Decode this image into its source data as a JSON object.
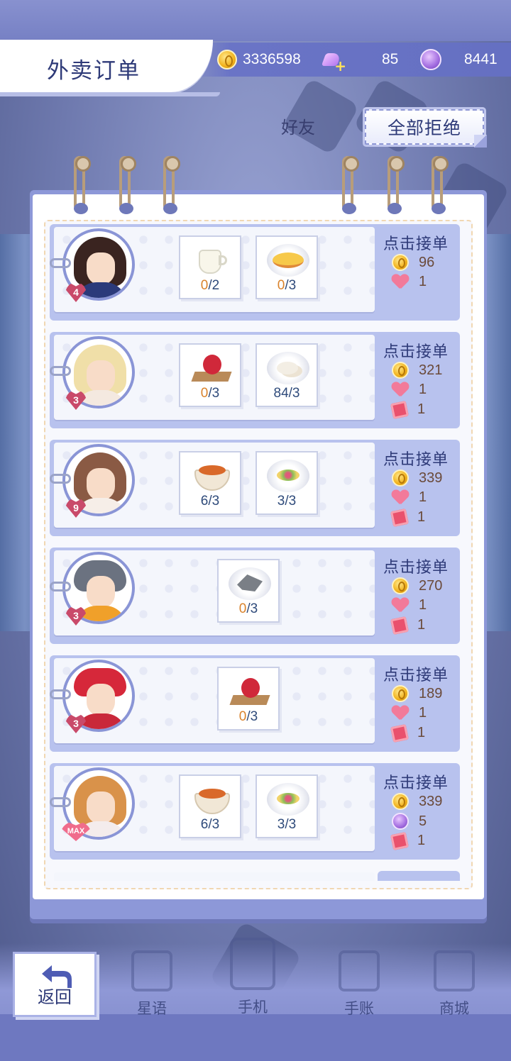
{
  "header": {
    "title": "外卖订单",
    "coins": "3336598",
    "swans": "85",
    "gems": "8441"
  },
  "actions": {
    "reject_all": "全部拒绝"
  },
  "bg_labels": {
    "friends": "好友"
  },
  "orders": [
    {
      "level": "4",
      "accept": "点击接单",
      "items": [
        {
          "have": "0",
          "need": "/2",
          "food": "milk"
        },
        {
          "have": "0",
          "need": "/3",
          "food": "omelette"
        }
      ],
      "rewards": [
        {
          "icon": "coin",
          "value": "96"
        },
        {
          "icon": "heart",
          "value": "1"
        }
      ]
    },
    {
      "level": "3",
      "accept": "点击接单",
      "items": [
        {
          "have": "0",
          "need": "/3",
          "food": "gift-cake"
        },
        {
          "have": "84",
          "need": "/3",
          "food": "dumplings"
        }
      ],
      "rewards": [
        {
          "icon": "coin",
          "value": "321"
        },
        {
          "icon": "heart",
          "value": "1"
        },
        {
          "icon": "ticket",
          "value": "1"
        }
      ]
    },
    {
      "level": "9",
      "accept": "点击接单",
      "items": [
        {
          "have": "6",
          "need": "/3",
          "food": "stew"
        },
        {
          "have": "3",
          "need": "/3",
          "food": "salad"
        }
      ],
      "rewards": [
        {
          "icon": "coin",
          "value": "339"
        },
        {
          "icon": "heart",
          "value": "1"
        },
        {
          "icon": "ticket",
          "value": "1"
        }
      ]
    },
    {
      "level": "3",
      "accept": "点击接单",
      "items": [
        {
          "have": "0",
          "need": "/3",
          "food": "fish"
        }
      ],
      "rewards": [
        {
          "icon": "coin",
          "value": "270"
        },
        {
          "icon": "heart",
          "value": "1"
        },
        {
          "icon": "ticket",
          "value": "1"
        }
      ]
    },
    {
      "level": "3",
      "accept": "点击接单",
      "items": [
        {
          "have": "0",
          "need": "/3",
          "food": "gift-cake"
        }
      ],
      "rewards": [
        {
          "icon": "coin",
          "value": "189"
        },
        {
          "icon": "heart",
          "value": "1"
        },
        {
          "icon": "ticket",
          "value": "1"
        }
      ]
    },
    {
      "level": "MAX",
      "accept": "点击接单",
      "items": [
        {
          "have": "6",
          "need": "/3",
          "food": "stew"
        },
        {
          "have": "3",
          "need": "/3",
          "food": "salad"
        }
      ],
      "rewards": [
        {
          "icon": "coin",
          "value": "339"
        },
        {
          "icon": "gem",
          "value": "5"
        },
        {
          "icon": "ticket",
          "value": "1"
        }
      ]
    }
  ],
  "nav": {
    "back": "返回",
    "items": [
      "星语",
      "手机",
      "手账",
      "商城"
    ]
  }
}
